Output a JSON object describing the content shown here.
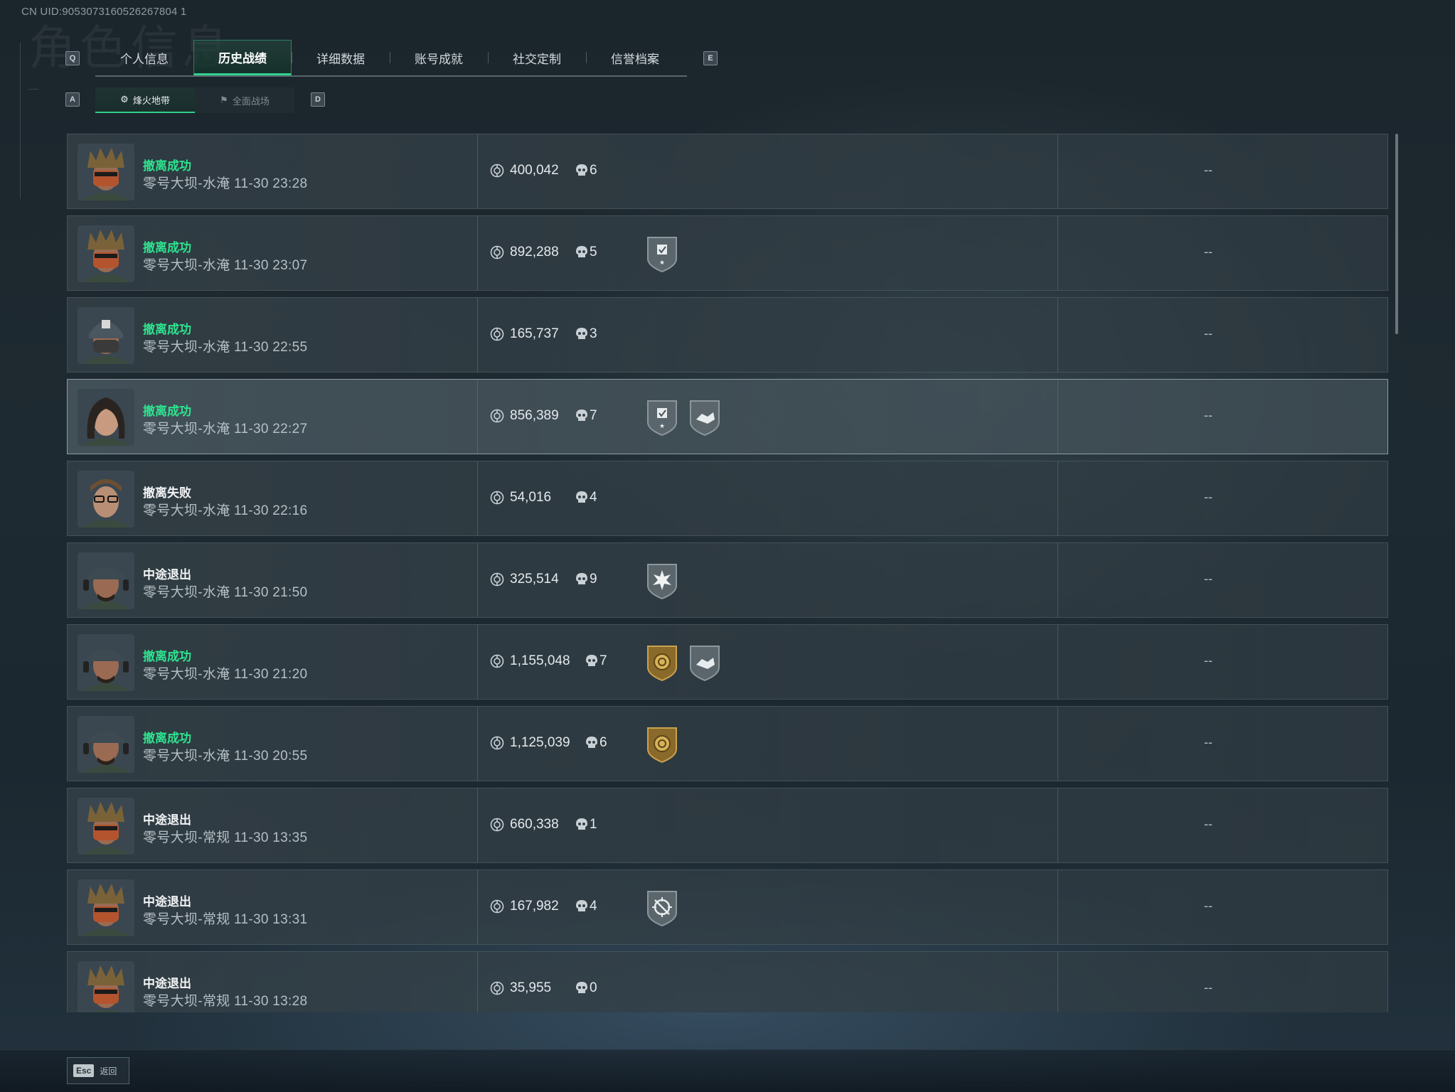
{
  "uid": "CN UID:9053073160526267804 1",
  "background_title": "角色信息",
  "keys": {
    "prev_tab": "Q",
    "next_tab": "E",
    "prev_sub": "A",
    "next_sub": "D"
  },
  "tabs": [
    {
      "label": "个人信息",
      "active": false
    },
    {
      "label": "历史战绩",
      "active": true
    },
    {
      "label": "详细数据",
      "active": false
    },
    {
      "label": "账号成就",
      "active": false
    },
    {
      "label": "社交定制",
      "active": false
    },
    {
      "label": "信誉档案",
      "active": false
    }
  ],
  "subtabs": [
    {
      "label": "烽火地带",
      "icon": "zone-icon",
      "active": true
    },
    {
      "label": "全面战场",
      "icon": "battlefield-icon",
      "active": false
    }
  ],
  "colors": {
    "accent": "#30d08e",
    "success": "#2ee38f",
    "row_bg": "#34404a"
  },
  "records": [
    {
      "avatar": "tribal-mask",
      "status": "撤离成功",
      "success": true,
      "map": "零号大坝-水淹 11-30 23:28",
      "value": "400,042",
      "kills": "6",
      "badges": [],
      "extra": "--",
      "highlight": false
    },
    {
      "avatar": "tribal-mask",
      "status": "撤离成功",
      "success": true,
      "map": "零号大坝-水淹 11-30 23:07",
      "value": "892,288",
      "kills": "5",
      "badges": [
        "shield-check-badge"
      ],
      "extra": "--",
      "highlight": false
    },
    {
      "avatar": "helmet-mask",
      "status": "撤离成功",
      "success": true,
      "map": "零号大坝-水淹 11-30 22:55",
      "value": "165,737",
      "kills": "3",
      "badges": [],
      "extra": "--",
      "highlight": false
    },
    {
      "avatar": "woman",
      "status": "撤离成功",
      "success": true,
      "map": "零号大坝-水淹 11-30 22:27",
      "value": "856,389",
      "kills": "7",
      "badges": [
        "shield-check-badge",
        "handshake-badge"
      ],
      "extra": "--",
      "highlight": true
    },
    {
      "avatar": "glasses",
      "status": "撤离失败",
      "success": false,
      "map": "零号大坝-水淹 11-30 22:16",
      "value": "54,016",
      "kills": "4",
      "badges": [],
      "extra": "--",
      "highlight": false
    },
    {
      "avatar": "cap-headset",
      "status": "中途退出",
      "success": false,
      "map": "零号大坝-水淹 11-30 21:50",
      "value": "325,514",
      "kills": "9",
      "badges": [
        "burst-badge"
      ],
      "extra": "--",
      "highlight": false
    },
    {
      "avatar": "cap-headset",
      "status": "撤离成功",
      "success": true,
      "map": "零号大坝-水淹 11-30 21:20",
      "value": "1,155,048",
      "kills": "7",
      "badges": [
        "gold-coin-badge",
        "handshake-badge"
      ],
      "extra": "--",
      "highlight": false
    },
    {
      "avatar": "cap-headset",
      "status": "撤离成功",
      "success": true,
      "map": "零号大坝-水淹 11-30 20:55",
      "value": "1,125,039",
      "kills": "6",
      "badges": [
        "gold-coin-badge"
      ],
      "extra": "--",
      "highlight": false
    },
    {
      "avatar": "tribal-mask",
      "status": "中途退出",
      "success": false,
      "map": "零号大坝-常规 11-30 13:35",
      "value": "660,338",
      "kills": "1",
      "badges": [],
      "extra": "--",
      "highlight": false
    },
    {
      "avatar": "tribal-mask",
      "status": "中途退出",
      "success": false,
      "map": "零号大坝-常规 11-30 13:31",
      "value": "167,982",
      "kills": "4",
      "badges": [
        "crosshair-badge"
      ],
      "extra": "--",
      "highlight": false
    },
    {
      "avatar": "tribal-mask",
      "status": "中途退出",
      "success": false,
      "map": "零号大坝-常规 11-30 13:28",
      "value": "35,955",
      "kills": "0",
      "badges": [],
      "extra": "--",
      "highlight": false
    }
  ],
  "footer": {
    "esc_key": "Esc",
    "back_label": "返回"
  }
}
